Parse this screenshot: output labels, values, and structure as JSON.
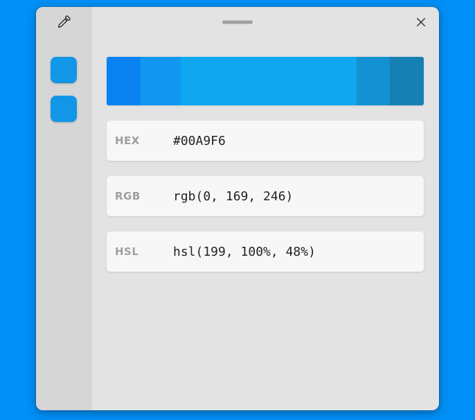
{
  "sidebar": {
    "swatches": [
      {
        "color": "#1297e8"
      },
      {
        "color": "#1297e8"
      }
    ]
  },
  "shades": [
    {
      "color": "#0a82f1",
      "flex": 1
    },
    {
      "color": "#1297f0",
      "flex": 1.2
    },
    {
      "color": "#0fa7ef",
      "flex": 5.2
    },
    {
      "color": "#1491d0",
      "flex": 1
    },
    {
      "color": "#1680b5",
      "flex": 1
    }
  ],
  "formats": {
    "hex": {
      "label": "HEX",
      "value": "#00A9F6"
    },
    "rgb": {
      "label": "RGB",
      "value": "rgb(0, 169, 246)"
    },
    "hsl": {
      "label": "HSL",
      "value": "hsl(199, 100%, 48%)"
    }
  }
}
